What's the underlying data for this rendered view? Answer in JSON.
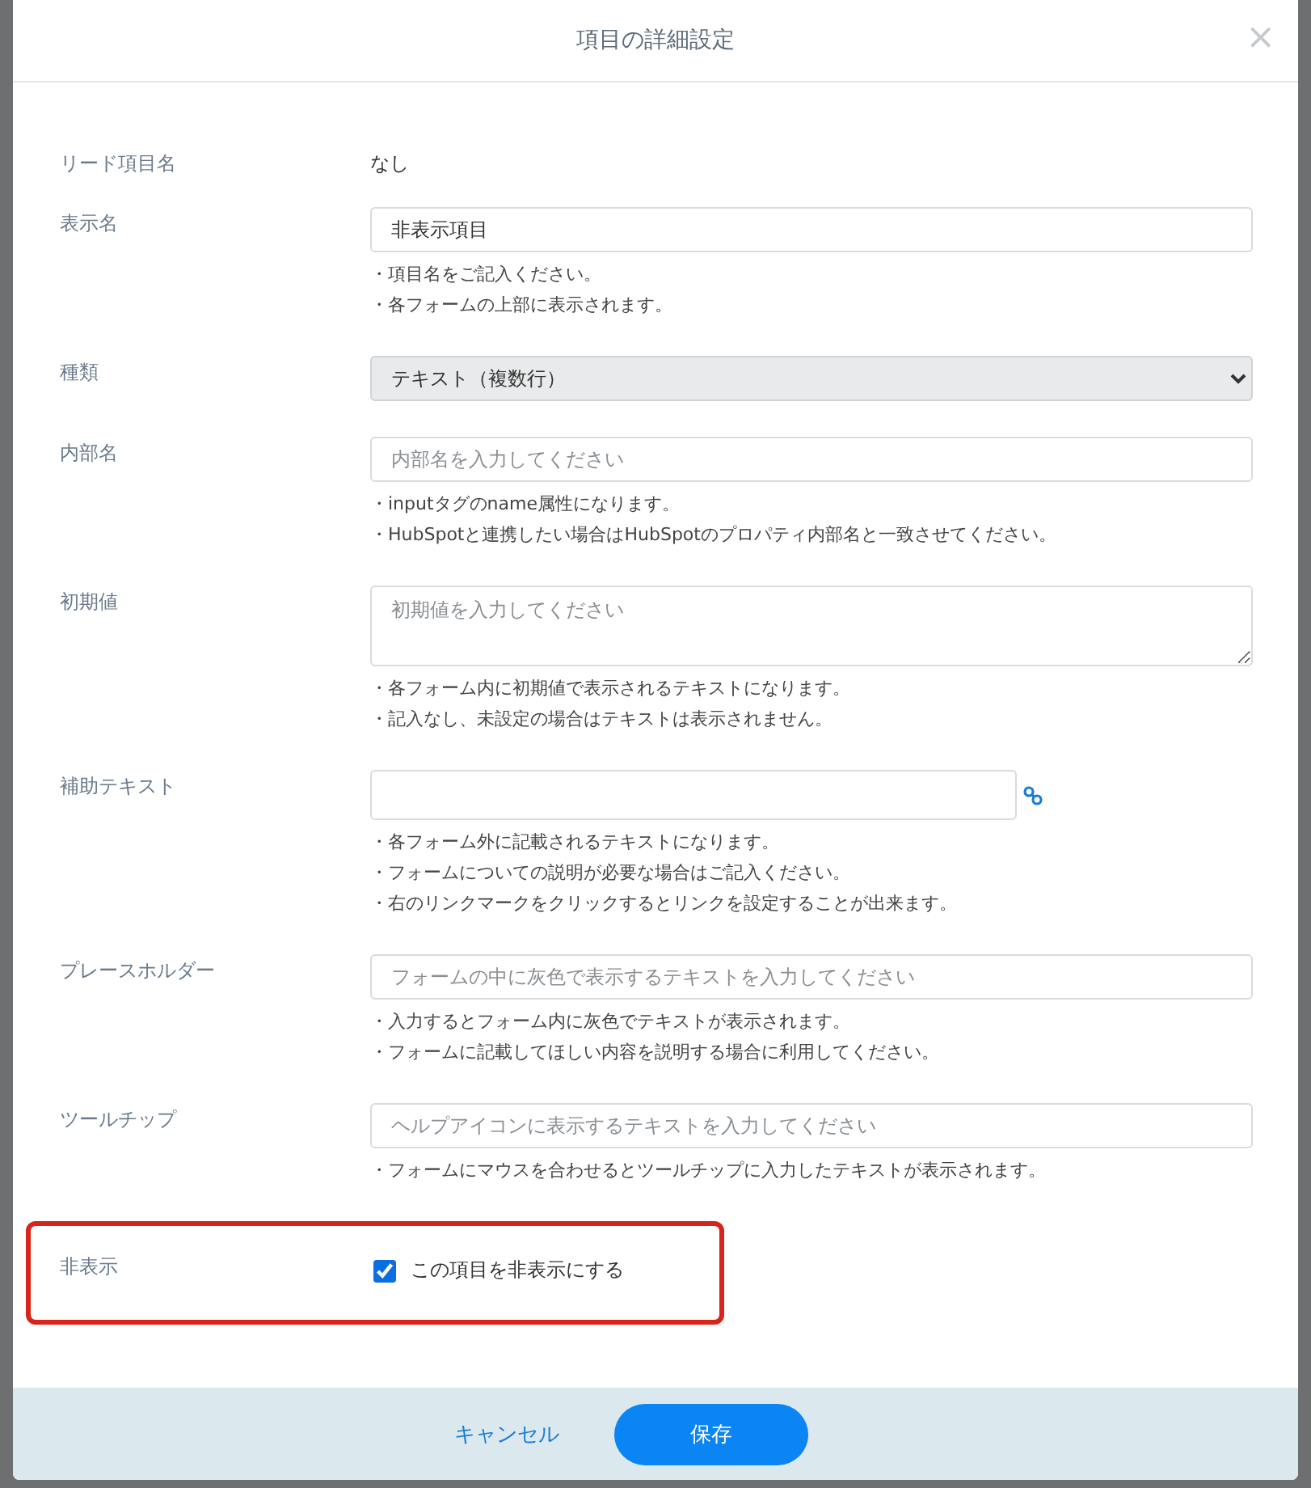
{
  "dialog": {
    "title": "項目の詳細設定",
    "close": "×"
  },
  "fields": [
    {
      "kind": "static",
      "label": "リード項目名",
      "value": "なし"
    },
    {
      "kind": "input",
      "label": "表示名",
      "value": "非表示項目",
      "hints": [
        "・項目名をご記入ください。",
        "・各フォームの上部に表示されます。"
      ]
    },
    {
      "kind": "select",
      "label": "種類",
      "value": "テキスト（複数行）"
    },
    {
      "kind": "input",
      "label": "内部名",
      "placeholder": "内部名を入力してください",
      "hints": [
        "・inputタグのname属性になります。",
        "・HubSpotと連携したい場合はHubSpotのプロパティ内部名と一致させてください。"
      ]
    },
    {
      "kind": "textarea",
      "label": "初期値",
      "placeholder": "初期値を入力してください",
      "hints": [
        "・各フォーム内に初期値で表示されるテキストになります。",
        "・記入なし、未設定の場合はテキストは表示されません。"
      ]
    },
    {
      "kind": "link-input",
      "label": "補助テキスト",
      "hints": [
        "・各フォーム外に記載されるテキストになります。",
        "・フォームについての説明が必要な場合はご記入ください。",
        "・右のリンクマークをクリックするとリンクを設定することが出来ます。"
      ]
    },
    {
      "kind": "input",
      "label": "プレースホルダー",
      "placeholder": "フォームの中に灰色で表示するテキストを入力してください",
      "hints": [
        "・入力するとフォーム内に灰色でテキストが表示されます。",
        "・フォームに記載してほしい内容を説明する場合に利用してください。"
      ]
    },
    {
      "kind": "input",
      "label": "ツールチップ",
      "placeholder": "ヘルプアイコンに表示するテキストを入力してください",
      "hints": [
        "・フォームにマウスを合わせるとツールチップに入力したテキストが表示されます。"
      ]
    },
    {
      "kind": "checkbox",
      "label": "非表示",
      "text": "この項目を非表示にする",
      "checked": true,
      "highlighted": true
    }
  ],
  "buttons": [
    {
      "kind": "link",
      "label": "キャンセル"
    },
    {
      "kind": "primary",
      "label": "保存"
    }
  ]
}
